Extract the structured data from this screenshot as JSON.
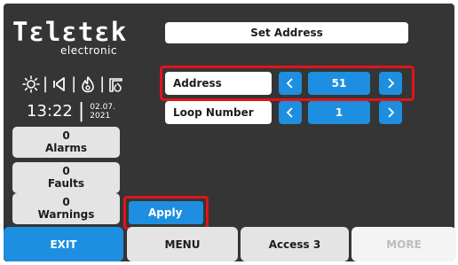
{
  "brand": {
    "name": "Tεlεtεk",
    "tagline": "electronic"
  },
  "status": {
    "icons": [
      "sun-icon",
      "speaker-icon",
      "flame-icon",
      "fire-alarm-icon"
    ]
  },
  "clock": {
    "time": "13:22",
    "date_line1": "02.07.",
    "date_line2": "2021"
  },
  "counters": [
    {
      "count": "0",
      "label": "Alarms"
    },
    {
      "count": "0",
      "label": "Faults"
    },
    {
      "count": "0",
      "label": "Warnings"
    }
  ],
  "form": {
    "title": "Set Address",
    "address": {
      "label": "Address",
      "value": "51"
    },
    "loop": {
      "label": "Loop Number",
      "value": "1"
    },
    "apply_label": "Apply"
  },
  "bottom_bar": {
    "exit": "EXIT",
    "menu": "MENU",
    "access": "Access 3",
    "more": "MORE"
  },
  "colors": {
    "panel": "#353535",
    "accent_blue": "#1e8fe0",
    "highlight_red": "#e0141c",
    "button_gray": "#e4e4e4"
  }
}
